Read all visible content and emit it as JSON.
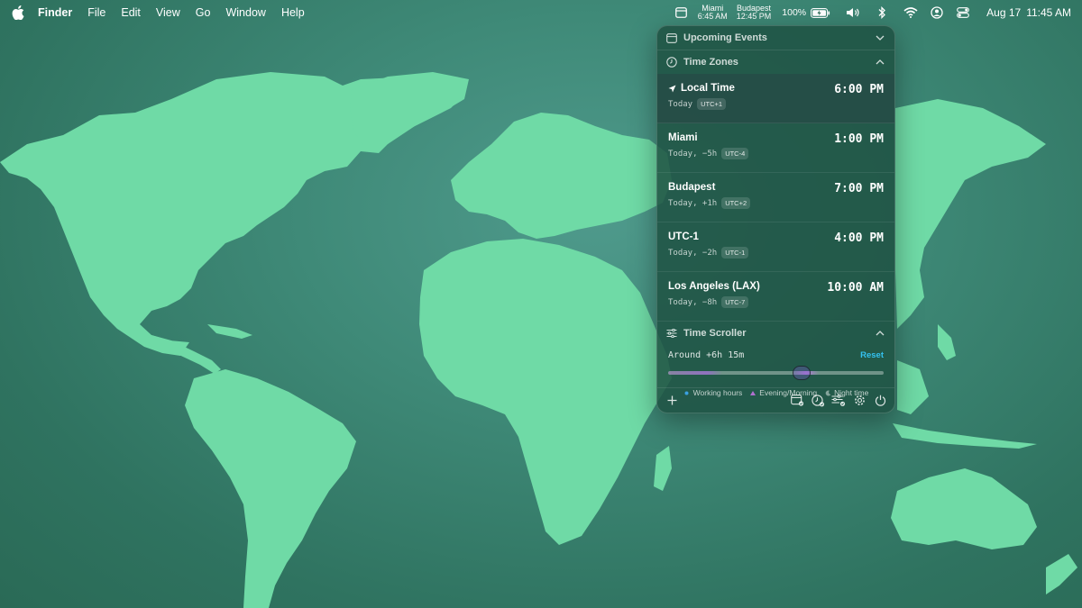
{
  "menubar": {
    "apple_icon": "apple-logo-icon",
    "app_name": "Finder",
    "menus": [
      "File",
      "Edit",
      "View",
      "Go",
      "Window",
      "Help"
    ],
    "clock_a_city": "Miami",
    "clock_a_time": "6:45 AM",
    "clock_b_city": "Budapest",
    "clock_b_time": "12:45 PM",
    "battery_percent": "100%",
    "date": "Aug 17",
    "time": "11:45 AM"
  },
  "panel": {
    "upcoming_events_label": "Upcoming Events",
    "time_zones_label": "Time Zones",
    "zones": [
      {
        "name": "Local Time",
        "sub": "Today",
        "badge": "UTC+1",
        "time": "6:00 PM"
      },
      {
        "name": "Miami",
        "sub": "Today, −5h",
        "badge": "UTC-4",
        "time": "1:00 PM"
      },
      {
        "name": "Budapest",
        "sub": "Today, +1h",
        "badge": "UTC+2",
        "time": "7:00 PM"
      },
      {
        "name": "UTC-1",
        "sub": "Today, −2h",
        "badge": "UTC-1",
        "time": "4:00 PM"
      },
      {
        "name": "Los Angeles (LAX)",
        "sub": "Today, −8h",
        "badge": "UTC-7",
        "time": "10:00 AM"
      }
    ],
    "time_scroller_label": "Time Scroller",
    "scroller_value": "Around +6h 15m",
    "scroller_position": 0.62,
    "reset_label": "Reset",
    "legend": {
      "working": "Working hours",
      "evening": "Evening/Morning",
      "night": "Night time"
    }
  },
  "colors": {
    "accent": "#34c2f0",
    "map_land": "#6fdaa6",
    "wallpaper": "#3f8a78"
  }
}
